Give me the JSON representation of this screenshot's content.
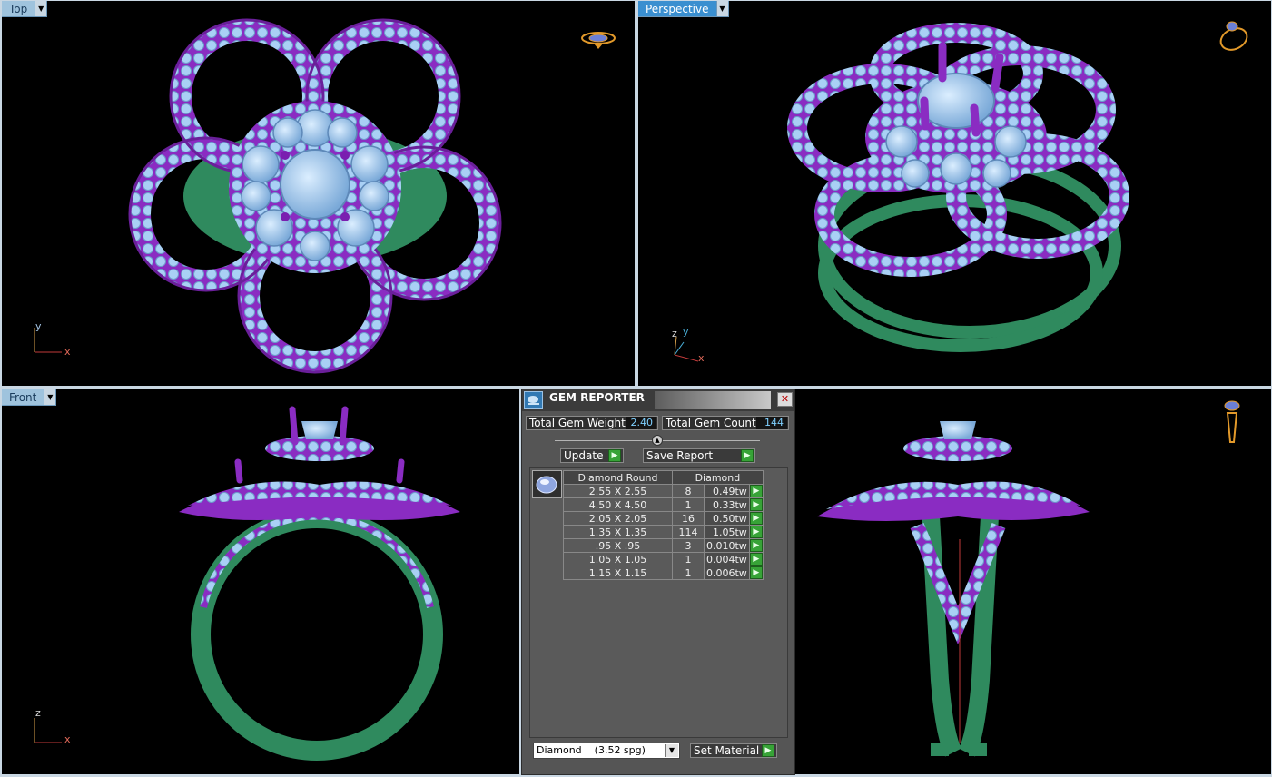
{
  "viewports": {
    "top": {
      "label": "Top",
      "axes": {
        "h": "x",
        "v": "y"
      }
    },
    "perspective": {
      "label": "Perspective",
      "axes": {
        "h": "x",
        "v": "y",
        "z": "z"
      }
    },
    "front": {
      "label": "Front",
      "axes": {
        "h": "x",
        "v": "z"
      }
    }
  },
  "gem_reporter": {
    "title": "GEM REPORTER",
    "close": "✕",
    "total_weight_label": "Total Gem Weight",
    "total_weight": "2.40",
    "total_count_label": "Total Gem Count",
    "total_count": "144",
    "update_label": "Update",
    "save_report_label": "Save Report",
    "table_header": {
      "shape": "Diamond Round",
      "material": "Diamond"
    },
    "rows": [
      {
        "size": "2.55 X 2.55",
        "count": "8",
        "weight": "0.49tw"
      },
      {
        "size": "4.50 X 4.50",
        "count": "1",
        "weight": "0.33tw"
      },
      {
        "size": "2.05 X 2.05",
        "count": "16",
        "weight": "0.50tw"
      },
      {
        "size": "1.35 X 1.35",
        "count": "114",
        "weight": "1.05tw"
      },
      {
        "size": ".95 X .95",
        "count": "3",
        "weight": "0.010tw"
      },
      {
        "size": "1.05 X 1.05",
        "count": "1",
        "weight": "0.004tw"
      },
      {
        "size": "1.15 X 1.15",
        "count": "1",
        "weight": "0.006tw"
      }
    ],
    "material_select": "Diamond    (3.52 spg)",
    "set_material_label": "Set Material"
  },
  "colors": {
    "metal_purple": "#8a2cc2",
    "gem_blue": "#9fc8f2",
    "band_green": "#2f8a5e",
    "active_label": "#3a8fd0"
  }
}
